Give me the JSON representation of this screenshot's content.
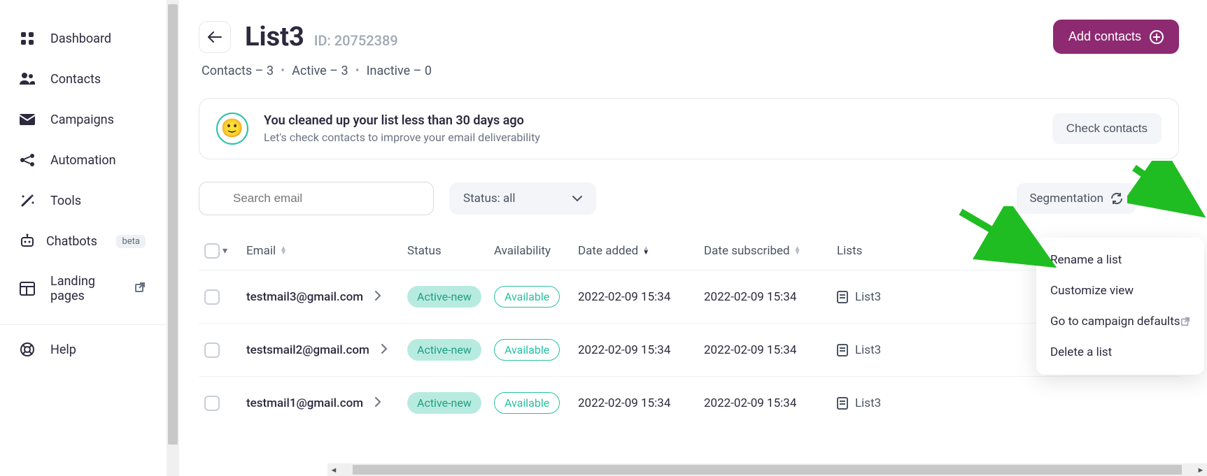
{
  "sidebar": {
    "items": [
      {
        "label": "Dashboard"
      },
      {
        "label": "Contacts"
      },
      {
        "label": "Campaigns"
      },
      {
        "label": "Automation"
      },
      {
        "label": "Tools"
      },
      {
        "label": "Chatbots",
        "badge": "beta"
      },
      {
        "label": "Landing pages",
        "external": true
      }
    ],
    "help": "Help"
  },
  "header": {
    "title": "List3",
    "id_prefix": "ID:",
    "id_value": "20752389",
    "add_contacts": "Add contacts"
  },
  "stats": {
    "contacts": "Contacts – 3",
    "active": "Active – 3",
    "inactive": "Inactive – 0"
  },
  "alert": {
    "title": "You cleaned up your list less than 30 days ago",
    "subtitle": "Let's check contacts to improve your email deliverability",
    "button": "Check contacts"
  },
  "filters": {
    "search_placeholder": "Search email",
    "status_label": "Status: all",
    "segmentation": "Segmentation"
  },
  "columns": {
    "email": "Email",
    "status": "Status",
    "availability": "Availability",
    "date_added": "Date added",
    "date_subscribed": "Date subscribed",
    "lists": "Lists"
  },
  "rows": [
    {
      "email": "testmail3@gmail.com",
      "status": "Active-new",
      "availability": "Available",
      "date_added": "2022-02-09 15:34",
      "date_subscribed": "2022-02-09 15:34",
      "list": "List3"
    },
    {
      "email": "testsmail2@gmail.com",
      "status": "Active-new",
      "availability": "Available",
      "date_added": "2022-02-09 15:34",
      "date_subscribed": "2022-02-09 15:34",
      "list": "List3"
    },
    {
      "email": "testmail1@gmail.com",
      "status": "Active-new",
      "availability": "Available",
      "date_added": "2022-02-09 15:34",
      "date_subscribed": "2022-02-09 15:34",
      "list": "List3"
    }
  ],
  "dropdown": {
    "rename": "Rename a list",
    "customize": "Customize view",
    "defaults": "Go to campaign defaults",
    "delete": "Delete a list"
  },
  "colors": {
    "brand": "#8e2a72",
    "accent": "#25c3a0",
    "arrow": "#1fbd22"
  }
}
